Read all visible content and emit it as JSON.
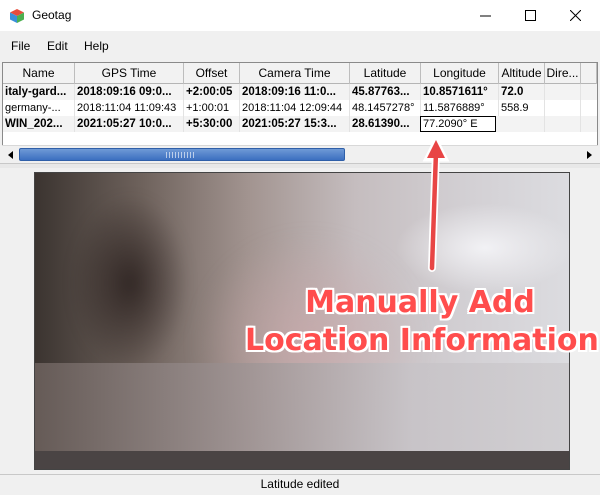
{
  "window": {
    "title": "Geotag",
    "icon": "geotag-app-icon"
  },
  "menu": [
    {
      "label": "File"
    },
    {
      "label": "Edit"
    },
    {
      "label": "Help"
    }
  ],
  "table": {
    "columns": [
      "Name",
      "GPS Time",
      "Offset",
      "Camera Time",
      "Latitude",
      "Longitude",
      "Altitude",
      "Dire..."
    ],
    "rows": [
      {
        "name": "italy-gard...",
        "gps_time": "2018:09:16 09:0...",
        "offset": "+2:00:05",
        "camera_time": "2018:09:16 11:0...",
        "latitude": "45.87763...",
        "longitude": "10.8571611°",
        "altitude": "72.0",
        "direction": ""
      },
      {
        "name": "germany-...",
        "gps_time": "2018:11:04 11:09:43",
        "offset": "+1:00:01",
        "camera_time": "2018:11:04 12:09:44",
        "latitude": "48.1457278°",
        "longitude": "11.5876889°",
        "altitude": "558.9",
        "direction": ""
      },
      {
        "name": "WIN_202...",
        "gps_time": "2021:05:27 10:0...",
        "offset": "+5:30:00",
        "camera_time": "2021:05:27 15:3...",
        "latitude": "28.61390...",
        "longitude": "77.2090° E",
        "altitude": "",
        "direction": ""
      }
    ]
  },
  "annotation": {
    "line1": "Manually Add",
    "line2": "Location Information",
    "color": "#ff4d4d"
  },
  "status": {
    "text": "Latitude edited"
  }
}
